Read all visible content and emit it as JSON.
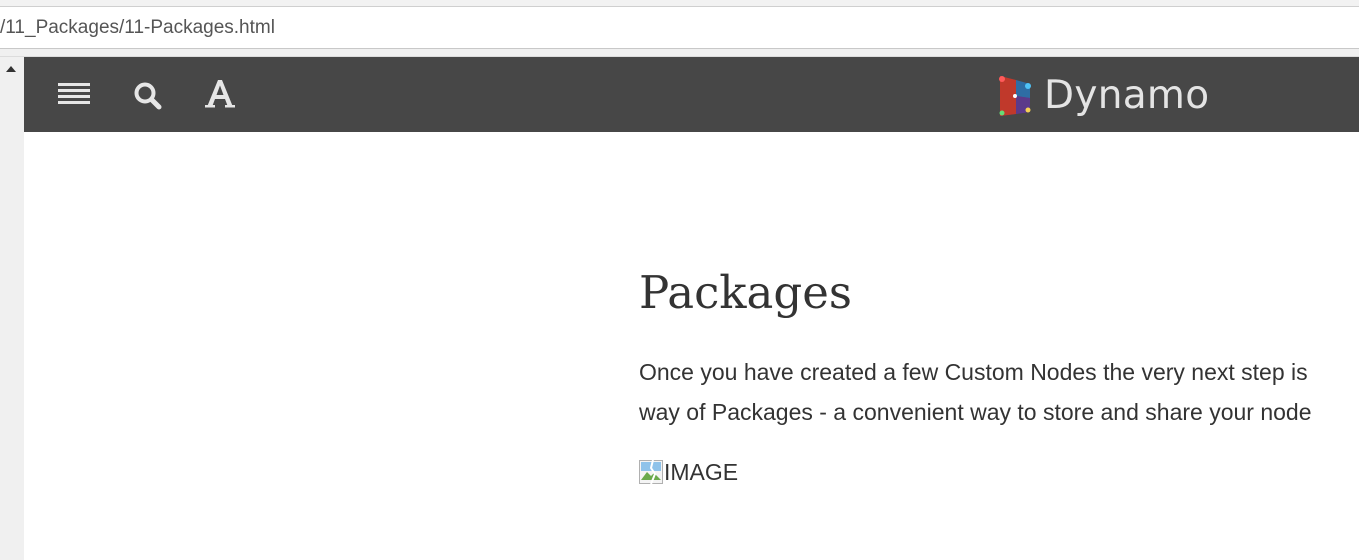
{
  "browser": {
    "url_text": "/11_Packages/11-Packages.html"
  },
  "toolbar": {
    "menu_icon": "hamburger-menu-icon",
    "search_icon": "search-icon",
    "font_icon": "font-settings-icon",
    "logo_text": "Dynamo"
  },
  "page": {
    "title": "Packages",
    "paragraph_line1": "Once you have created a few Custom Nodes the very next step is",
    "paragraph_line2": "way of Packages - a convenient way to store and share your node",
    "image_alt": "IMAGE"
  },
  "colors": {
    "header_bg": "#474747",
    "icon_color": "#e6e6e6",
    "text_color": "#333333"
  }
}
